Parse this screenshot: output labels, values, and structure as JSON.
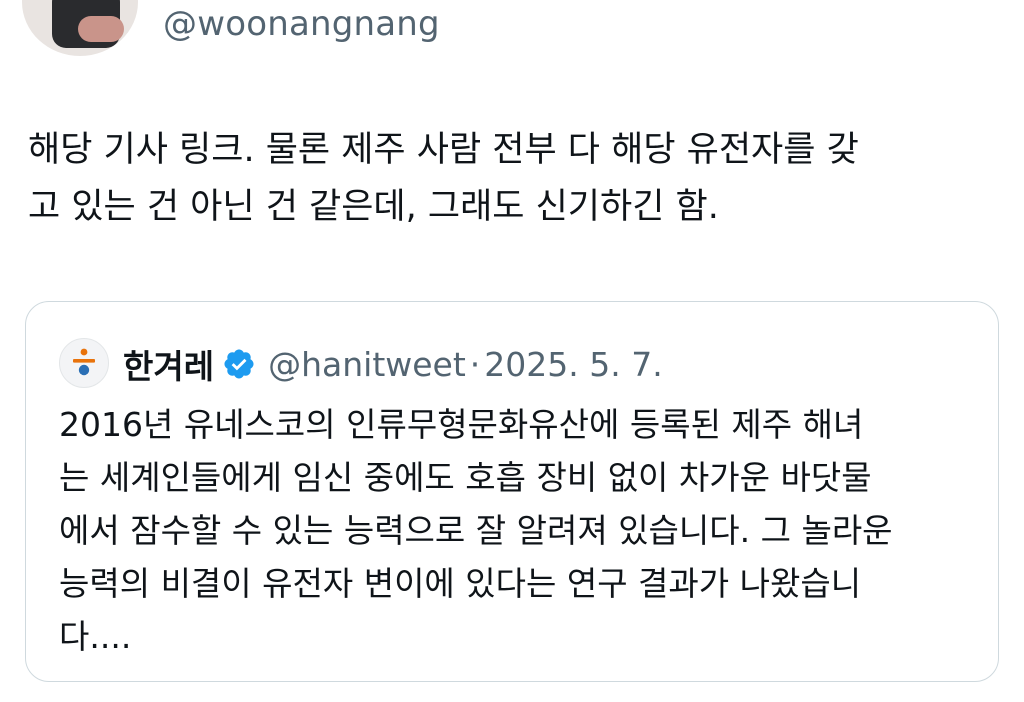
{
  "author": {
    "handle": "@woonangnang"
  },
  "tweet": {
    "text": "해당 기사 링크. 물론 제주 사람 전부 다 해당 유전자를 갖\n고 있는 건 아닌 건 같은데, 그래도 신기하긴 함."
  },
  "quote": {
    "name": "한겨레",
    "handle": "@hanitweet",
    "separator": "·",
    "date": "2025. 5. 7.",
    "verified_icon": "verified-badge-icon",
    "text": "2016년 유네스코의 인류무형문화유산에 등록된 제주 해녀\n는 세계인들에게 임신 중에도 호흡 장비 없이 차가운 바닷물\n에서 잠수할 수 있는 능력으로 잘 알려져 있습니다. 그 놀라운\n능력의 비결이 유전자 변이에 있다는 연구 결과가 나왔습니\n다...."
  },
  "colors": {
    "text_primary": "#0f1419",
    "text_secondary": "#536471",
    "border": "#cfd9de",
    "verified_blue": "#1d9bf0",
    "logo_orange": "#e8730c",
    "logo_blue": "#2a6fb5"
  }
}
